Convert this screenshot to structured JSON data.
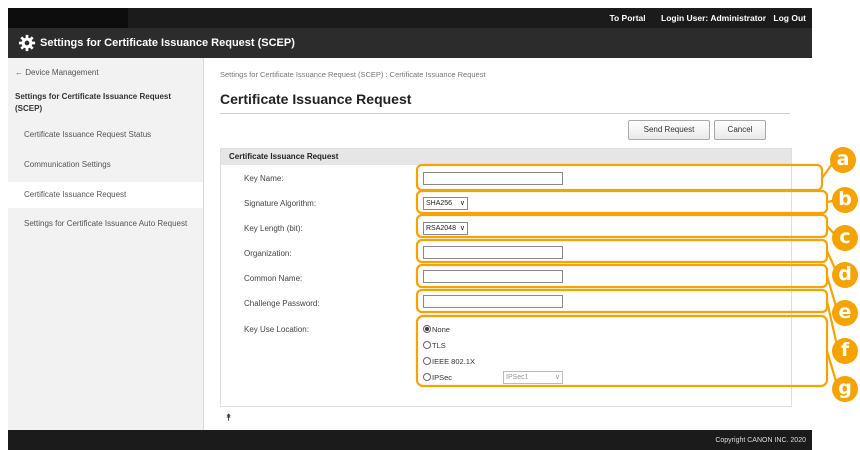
{
  "topbar": {
    "to_portal": "To Portal",
    "login_user": "Login User:",
    "user_name": "Administrator",
    "logout": "Log Out"
  },
  "title_bar": {
    "title": "Settings for Certificate Issuance Request (SCEP)",
    "icon": "gear-icon"
  },
  "sidebar": {
    "back_link": "← Device Management",
    "section_title": "Settings for Certificate Issuance Request (SCEP)",
    "items": [
      {
        "label": "Certificate Issuance Request Status"
      },
      {
        "label": "Communication Settings"
      },
      {
        "label": "Certificate Issuance Request",
        "active": true
      },
      {
        "label": "Settings for Certificate Issuance Auto Request"
      }
    ]
  },
  "main": {
    "breadcrumb": "Settings for Certificate Issuance Request (SCEP) : Certificate Issuance Request",
    "page_title": "Certificate Issuance Request",
    "send_request": "Send Request",
    "cancel": "Cancel",
    "panel_title": "Certificate Issuance Request",
    "fields": {
      "key_name": {
        "label": "Key Name:",
        "value": ""
      },
      "signature_algorithm": {
        "label": "Signature Algorithm:",
        "selected": "SHA256"
      },
      "key_length": {
        "label": "Key Length (bit):",
        "selected": "RSA2048"
      },
      "organization": {
        "label": "Organization:",
        "value": ""
      },
      "common_name": {
        "label": "Common Name:",
        "value": ""
      },
      "challenge_password": {
        "label": "Challenge Password:",
        "value": ""
      },
      "key_use_location": {
        "label": "Key Use Location:",
        "options": [
          "None",
          "TLS",
          "IEEE 802.1X",
          "IPSec"
        ],
        "selected": "None",
        "ipsec_select": "IPSec1"
      }
    },
    "back_to_top": "⯭"
  },
  "footer": {
    "copyright": "Copyright CANON INC. 2020"
  },
  "callouts": [
    "a",
    "b",
    "c",
    "d",
    "e",
    "f",
    "g"
  ],
  "colors": {
    "callout": "#f5a300",
    "topbar": "#1b1b1b",
    "titlebar": "#2c2c2c",
    "sidebar": "#f2f2f2"
  }
}
